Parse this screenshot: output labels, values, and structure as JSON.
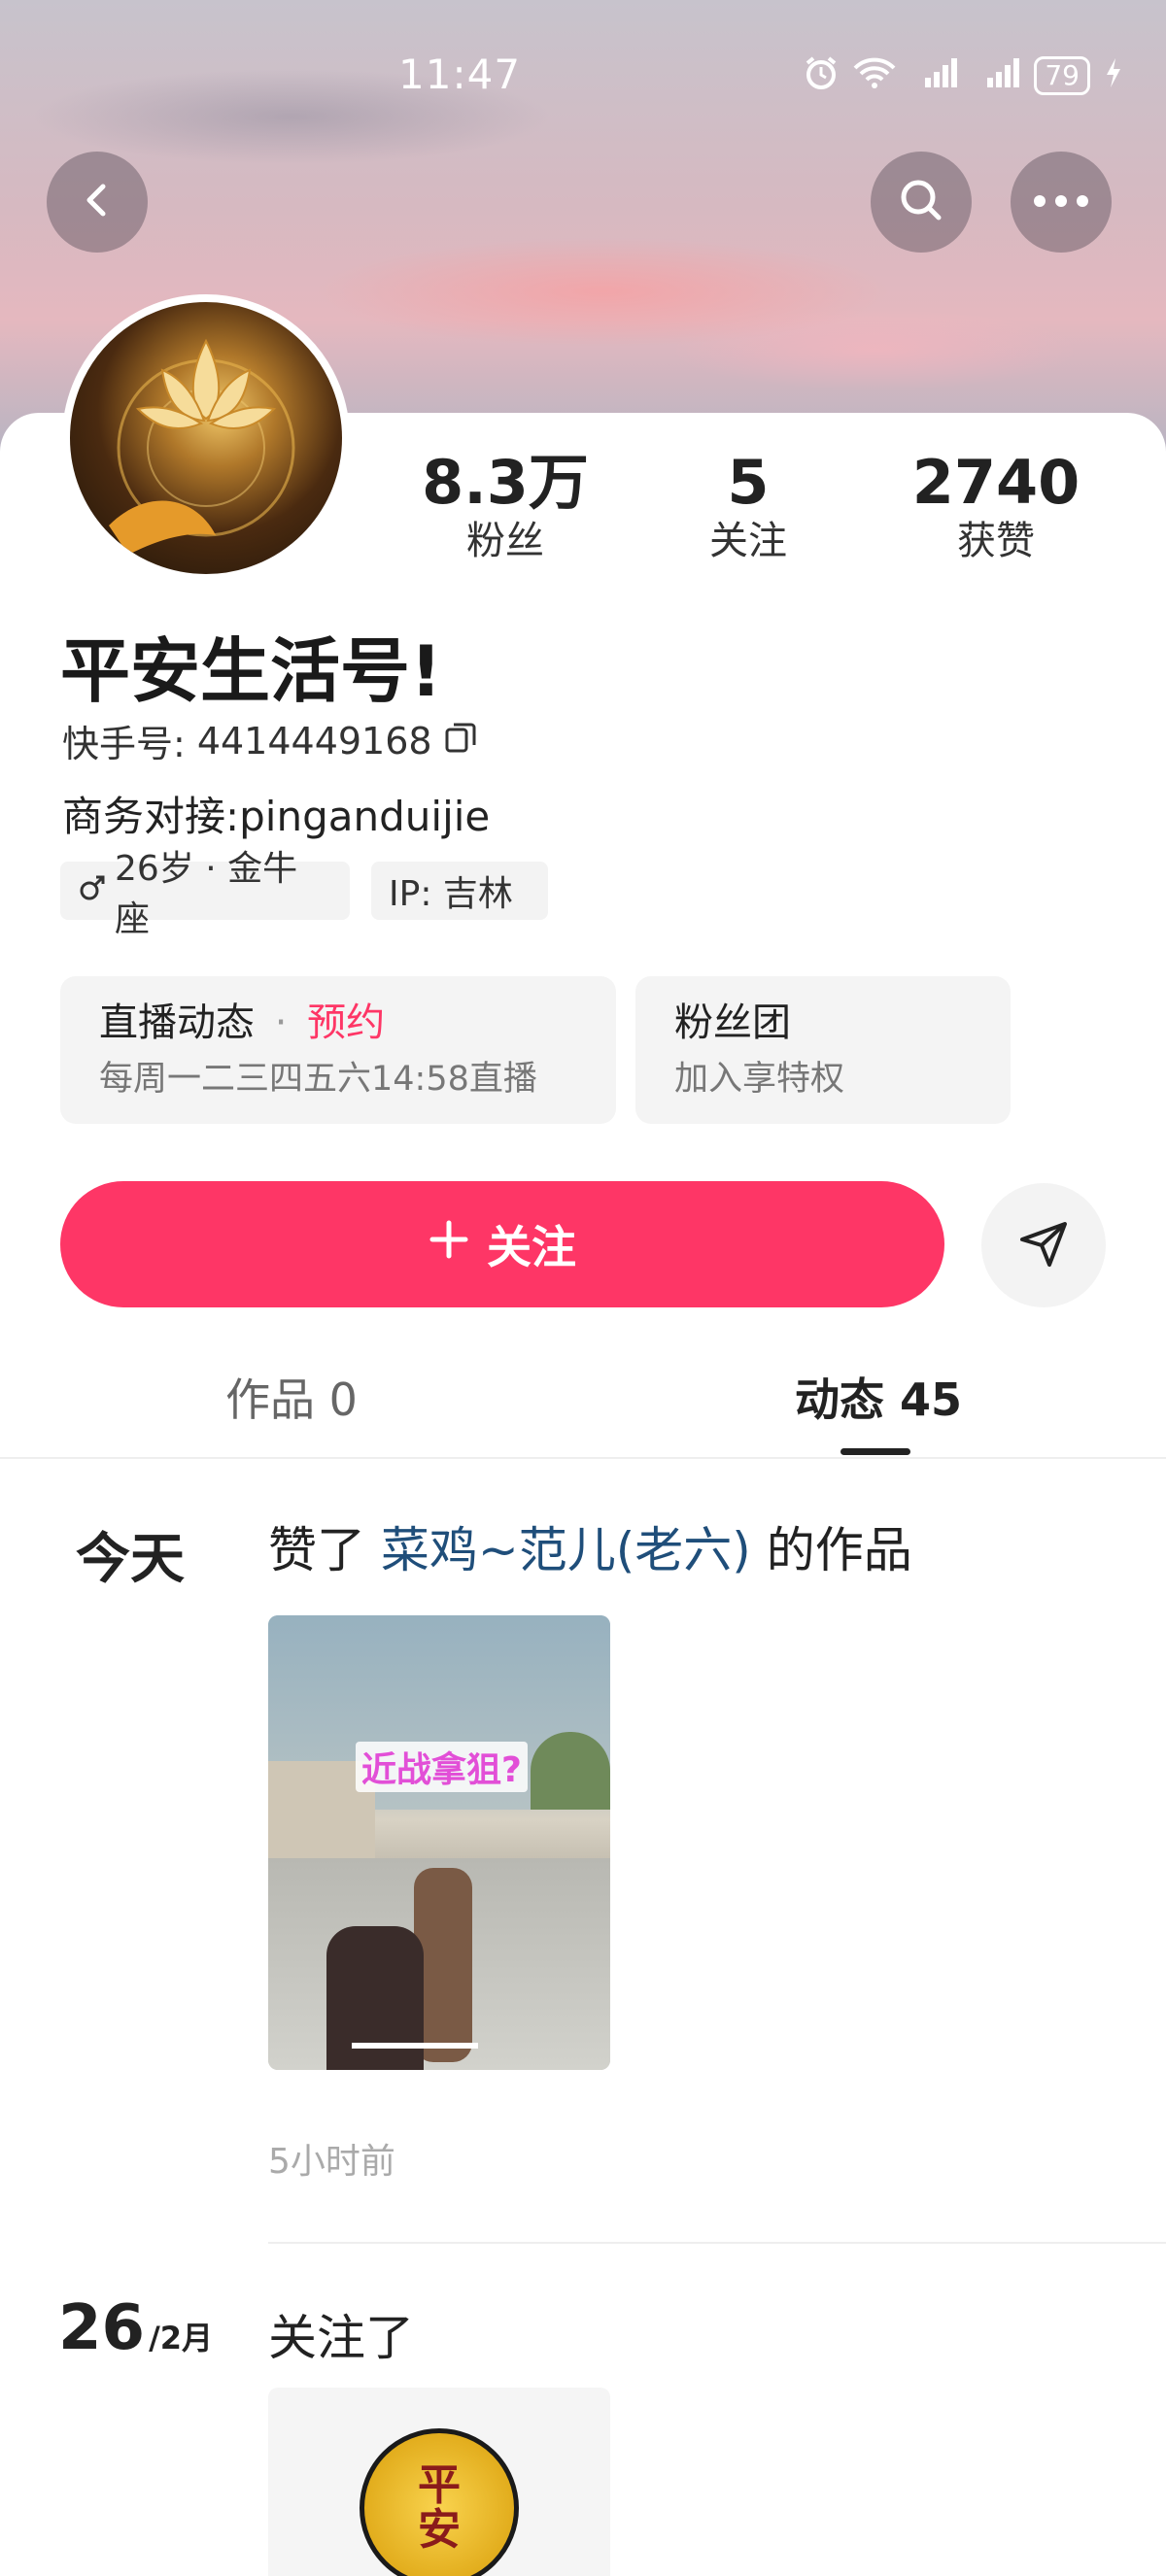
{
  "status_bar": {
    "time": "11:47",
    "battery": "79"
  },
  "profile": {
    "stats": [
      {
        "value": "8.3万",
        "label": "粉丝"
      },
      {
        "value": "5",
        "label": "关注"
      },
      {
        "value": "2740",
        "label": "获赞"
      }
    ],
    "name": "平安生活号!",
    "kuaishou_id_label": "快手号:",
    "kuaishou_id": "4414449168",
    "business": "商务对接:pinganduijie",
    "tags": {
      "age": "26岁 · 金牛座",
      "ip": "IP:  吉林"
    }
  },
  "live_box": {
    "title": "直播动态",
    "sep": "·",
    "reserve": "预约",
    "schedule": "每周一二三四五六14:58直播"
  },
  "fan_box": {
    "title": "粉丝团",
    "sub": "加入享特权"
  },
  "actions": {
    "follow_label": "关注"
  },
  "tabs": [
    {
      "label": "作品 0"
    },
    {
      "label": "动态 45"
    }
  ],
  "feed": [
    {
      "date": "今天",
      "action": "赞了",
      "target": "菜鸡~范儿(老六)",
      "suffix": "的作品",
      "thumb_caption": "近战拿狙?",
      "time_ago": "5小时前"
    },
    {
      "date_day": "26",
      "date_month": "/2月",
      "action": "关注了",
      "coin_text": "平安"
    }
  ],
  "colors": {
    "accent": "#fe3666",
    "link": "#1f4e7a"
  }
}
